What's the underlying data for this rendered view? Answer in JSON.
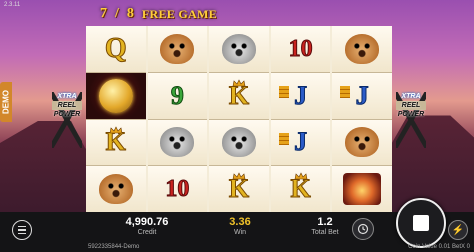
{
  "version": "2.3.11",
  "demo_tab": "DEMO",
  "header": {
    "count_current": "7",
    "separator": "/",
    "count_total": "8",
    "mode_label": "FREE GAME"
  },
  "side_badge": {
    "line1": "XTRA",
    "line2": "REEL",
    "line3": "POWER"
  },
  "reels": [
    [
      {
        "symbol": "Q",
        "kind": "q"
      },
      {
        "symbol": "coin",
        "kind": "coin"
      },
      {
        "symbol": "K",
        "kind": "k"
      },
      {
        "symbol": "cougar",
        "kind": "cougar"
      }
    ],
    [
      {
        "symbol": "cougar",
        "kind": "cougar"
      },
      {
        "symbol": "9",
        "kind": "nine"
      },
      {
        "symbol": "wolf",
        "kind": "wolf"
      },
      {
        "symbol": "10",
        "kind": "ten"
      }
    ],
    [
      {
        "symbol": "wolf",
        "kind": "wolf"
      },
      {
        "symbol": "K",
        "kind": "k"
      },
      {
        "symbol": "wolf",
        "kind": "wolf"
      },
      {
        "symbol": "K",
        "kind": "k"
      }
    ],
    [
      {
        "symbol": "10",
        "kind": "ten"
      },
      {
        "symbol": "J",
        "kind": "j"
      },
      {
        "symbol": "J",
        "kind": "j"
      },
      {
        "symbol": "K",
        "kind": "k"
      }
    ],
    [
      {
        "symbol": "cougar",
        "kind": "cougar"
      },
      {
        "symbol": "J",
        "kind": "j"
      },
      {
        "symbol": "cougar",
        "kind": "cougar"
      },
      {
        "symbol": "sunset",
        "kind": "sunset"
      }
    ]
  ],
  "bottom_bar": {
    "credit_value": "4,990.76",
    "credit_label": "Credit",
    "win_value": "3.36",
    "win_label": "Win",
    "total_bet_value": "1.2",
    "total_bet_label": "Total Bet",
    "session_id": "5922335844-Demo",
    "coin_info": "Coin Value 0.01 BetX 0"
  }
}
